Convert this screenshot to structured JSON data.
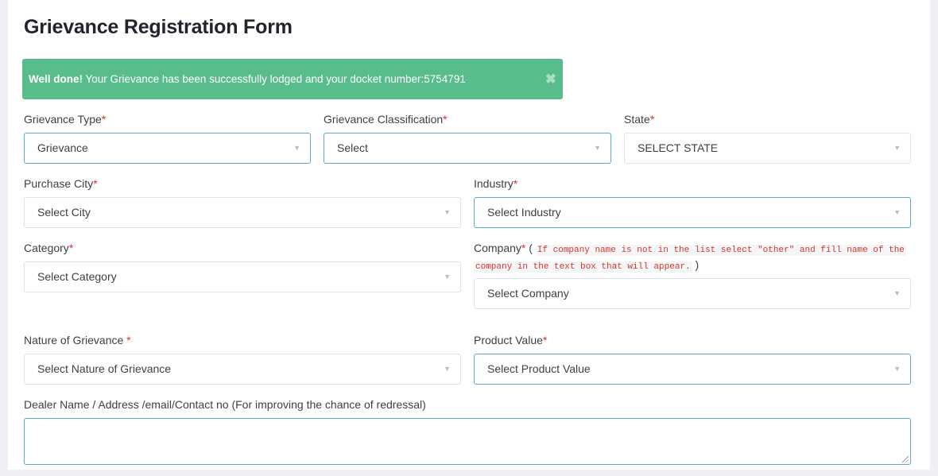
{
  "page": {
    "title": "Grievance Registration Form"
  },
  "alert": {
    "strong": "Well done!",
    "message": " Your Grievance has been successfully lodged and your docket number:5754791",
    "close_icon": "✖",
    "color": "#58bd8b"
  },
  "required_mark": "*",
  "fields": {
    "grievance_type": {
      "label": "Grievance Type",
      "value": "Grievance"
    },
    "grievance_classification": {
      "label": "Grievance Classification",
      "value": "Select"
    },
    "state": {
      "label": "State",
      "value": "SELECT STATE"
    },
    "purchase_city": {
      "label": "Purchase City",
      "value": "Select City"
    },
    "industry": {
      "label": "Industry",
      "value": "Select Industry"
    },
    "category": {
      "label": "Category",
      "value": "Select Category"
    },
    "company": {
      "label": "Company",
      "paren_open": " ( ",
      "hint_line1": "If company name is not in the list select \"other\" and fill name of the",
      "hint_line2": "company in the text box that will appear.",
      "paren_close": " )",
      "value": "Select Company"
    },
    "nature_of_grievance": {
      "label": "Nature of Grievance ",
      "value": "Select Nature of Grievance"
    },
    "product_value": {
      "label": "Product Value",
      "value": "Select Product Value"
    },
    "dealer_info": {
      "label": "Dealer Name / Address /email/Contact no (For improving the chance of redressal)",
      "value": ""
    }
  },
  "caret_icon": "▼"
}
